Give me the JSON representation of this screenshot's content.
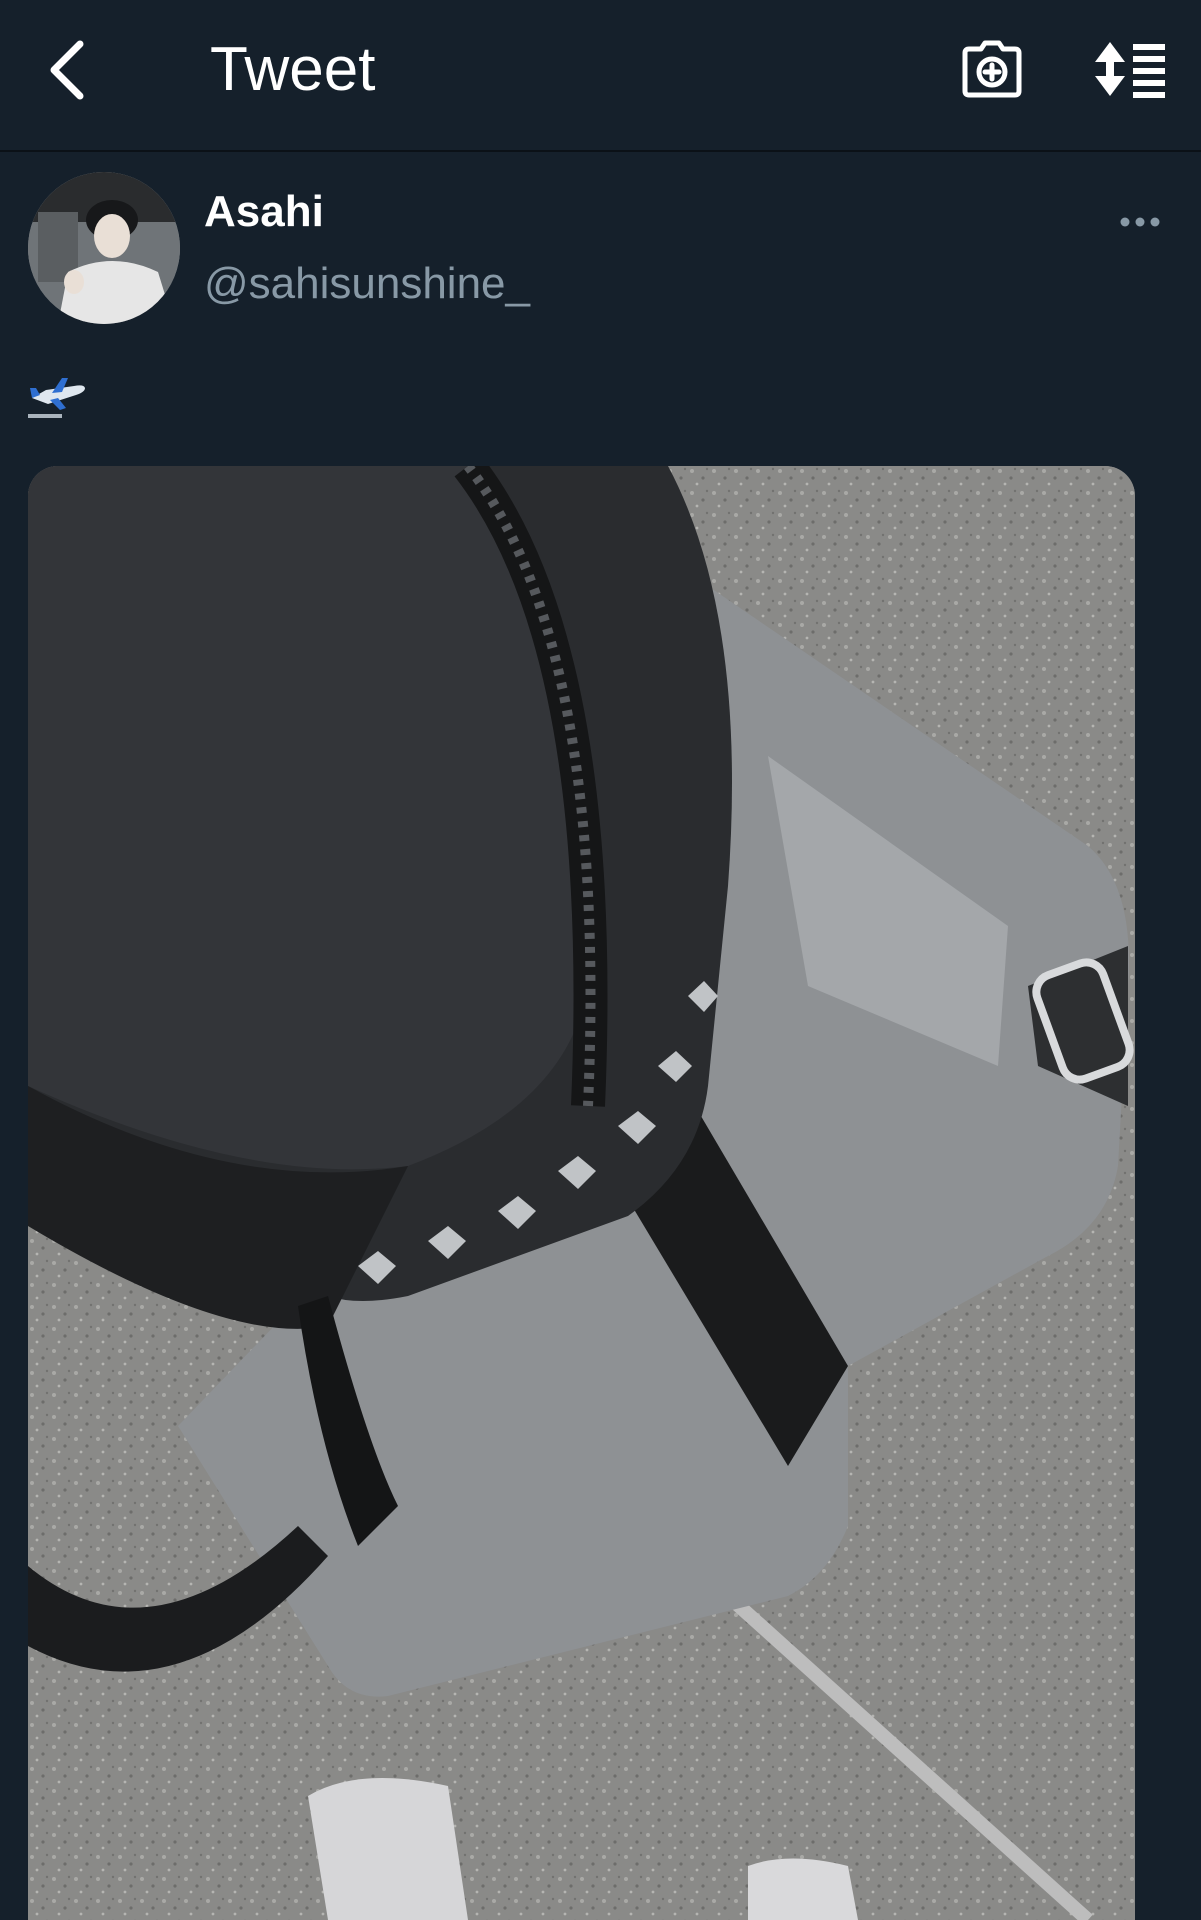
{
  "header": {
    "title": "Tweet",
    "back_icon": "chevron-left-icon",
    "camera_icon": "camera-add-icon",
    "sort_icon": "sort-list-icon"
  },
  "tweet": {
    "author": {
      "display_name": "Asahi",
      "handle": "@sahisunshine_"
    },
    "more_icon": "more-horizontal-icon",
    "text_icon": "airplane-departure-emoji",
    "media_description": "photo"
  },
  "colors": {
    "background": "#15202b",
    "text_primary": "#ffffff",
    "text_secondary": "#8899a6"
  }
}
